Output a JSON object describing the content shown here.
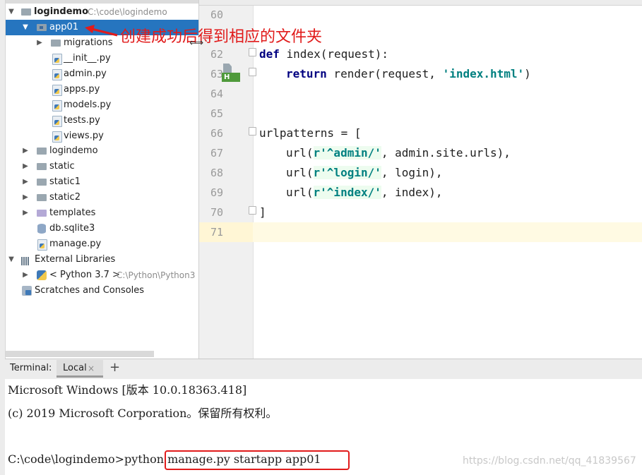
{
  "project_tree": {
    "root": {
      "name": "logindemo",
      "path": "C:\\code\\logindemo"
    },
    "selected": "app01",
    "app01_children": [
      "migrations",
      "__init__.py",
      "admin.py",
      "apps.py",
      "models.py",
      "tests.py",
      "views.py"
    ],
    "folders": [
      "logindemo",
      "static",
      "static1",
      "static2",
      "templates"
    ],
    "files": [
      "db.sqlite3",
      "manage.py"
    ],
    "external_libraries": "External Libraries",
    "python_sdk": {
      "name": "< Python 3.7 >",
      "path": "C:\\Python\\Python3"
    },
    "scratches": "Scratches and Consoles"
  },
  "annotation": {
    "text": "创建成功后得到相应的文件夹",
    "color": "#e11b1b"
  },
  "editor": {
    "line_numbers": [
      "60",
      "62",
      "63",
      "64",
      "65",
      "66",
      "67",
      "68",
      "69",
      "70",
      "71"
    ],
    "code": {
      "l62_kw": "def",
      "l62_rest": " index(request):",
      "l63_kw": "return",
      "l63_pre": " render(request, ",
      "l63_str": "'index.html'",
      "l63_post": ")",
      "l66": "urlpatterns = [",
      "l67_pre": "url(",
      "l67_str": "r'^admin/'",
      "l67_post": ", admin.site.urls),",
      "l68_pre": "url(",
      "l68_str": "r'^login/'",
      "l68_post": ", login),",
      "l69_pre": "url(",
      "l69_str": "r'^index/'",
      "l69_post": ", index),",
      "l70": "]"
    },
    "gutter_badge": "H"
  },
  "terminal": {
    "title": "Terminal:",
    "tab": "Local",
    "tab_close": "×",
    "add": "+",
    "lines": [
      "Microsoft Windows [版本 10.0.18363.418]",
      "(c) 2019 Microsoft Corporation。保留所有权利。",
      "C:\\code\\logindemo>python manage.py startapp app01"
    ]
  },
  "watermark": "https://blog.csdn.net/qq_41839567",
  "colors": {
    "selection": "#2675bf",
    "highlight_box": "#e11b1b",
    "keyword": "#000080",
    "string": "#008080"
  }
}
